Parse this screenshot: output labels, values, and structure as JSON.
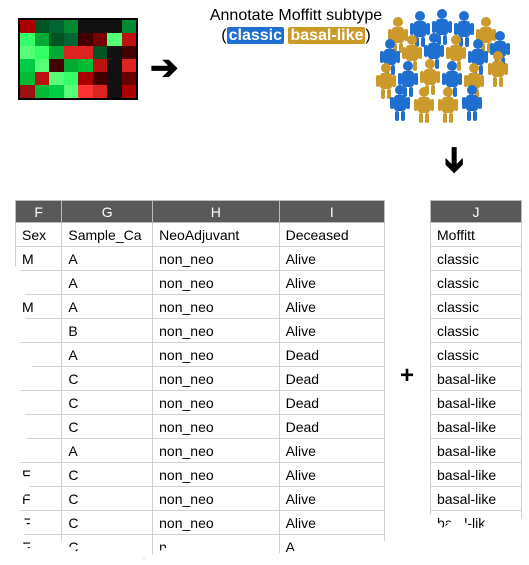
{
  "caption": {
    "line1": "Annotate Moffitt subtype",
    "classic_label": "classic",
    "basal_label": "basal-like"
  },
  "plus": "+",
  "table_main": {
    "col_letters": [
      "F",
      "G",
      "H",
      "I"
    ],
    "headers": [
      "Sex",
      "Sample_Ca",
      "NeoAdjuvant",
      "Deceased"
    ],
    "rows": [
      [
        "M",
        "A",
        "non_neo",
        "Alive"
      ],
      [
        "",
        "A",
        "non_neo",
        "Alive"
      ],
      [
        "M",
        "A",
        "non_neo",
        "Alive"
      ],
      [
        "",
        "B",
        "non_neo",
        "Alive"
      ],
      [
        "",
        "A",
        "non_neo",
        "Dead"
      ],
      [
        "",
        "C",
        "non_neo",
        "Dead"
      ],
      [
        "",
        "C",
        "non_neo",
        "Dead"
      ],
      [
        "",
        "C",
        "non_neo",
        "Dead"
      ],
      [
        "",
        "A",
        "non_neo",
        "Alive"
      ],
      [
        "F",
        "C",
        "non_neo",
        "Alive"
      ],
      [
        "F",
        "C",
        "non_neo",
        "Alive"
      ],
      [
        "F",
        "C",
        "non_neo",
        "Alive"
      ],
      [
        "F",
        "C",
        "n  n  r",
        "A"
      ]
    ]
  },
  "table_j": {
    "col_letters": [
      "J"
    ],
    "headers": [
      "Moffitt"
    ],
    "rows": [
      [
        "classic"
      ],
      [
        "classic"
      ],
      [
        "classic"
      ],
      [
        "classic"
      ],
      [
        "classic"
      ],
      [
        "basal-like"
      ],
      [
        "basal-like"
      ],
      [
        "basal-like"
      ],
      [
        "basal-like"
      ],
      [
        "basal-like"
      ],
      [
        "basal-like"
      ],
      [
        "ba  al-lik"
      ]
    ]
  },
  "icons": {
    "arrow_right": "arrow-right-icon",
    "arrow_down": "arrow-down-icon",
    "crowd": "people-crowd-icon",
    "heatmap": "heatmap-thumbnail"
  },
  "colors": {
    "classic": "#1f6fd0",
    "basal": "#cb9a2b"
  }
}
